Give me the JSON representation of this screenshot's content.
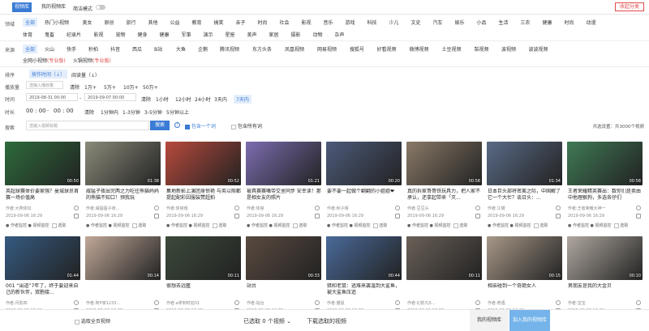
{
  "tabs": [
    {
      "label": "视频库"
    },
    {
      "label": "我的视频库"
    }
  ],
  "mode_label": "简洁模式",
  "fav_button": "收起分类",
  "labels": {
    "domain": "领域",
    "source": "来源",
    "sort": "排序",
    "plays": "播放量",
    "time": "时间",
    "duration": "时长",
    "search": "搜索"
  },
  "domain_row1": [
    "全部",
    "热门小视频",
    "美女",
    "原创",
    "旅行",
    "其他",
    "公益",
    "教育",
    "搞笑",
    "亲子",
    "时尚",
    "社会",
    "影视",
    "音乐",
    "游戏",
    "科技",
    "少儿",
    "文史",
    "汽车",
    "娱乐",
    "小品",
    "生活",
    "三农",
    "健康",
    "时尚",
    "动漫"
  ],
  "domain_row2": [
    "体育",
    "鬼畜",
    "纪录片",
    "影视",
    "宠物",
    "健身",
    "健康",
    "军事",
    "演示",
    "星座",
    "美声",
    "家居",
    "摄影",
    "动物",
    "杂声"
  ],
  "source_row1": [
    "全部",
    "火山",
    "快手",
    "秒拍",
    "抖音",
    "西瓜",
    "B站",
    "大鱼",
    "企鹅",
    "腾讯视频",
    "东方头条",
    "凤凰视频",
    "网易视频",
    "搜狐号",
    "好看视频",
    "微博视频",
    "土豆视频",
    "梨视频",
    "波视频",
    "波波视频"
  ],
  "source_row1_tags": [
    "(专业版)",
    "(专业版)",
    "(专业版)",
    "(专业版)",
    "(专业版)",
    "(专业版)"
  ],
  "source_row2": [
    "全网小视频",
    "火锅视频"
  ],
  "sort_opts": [
    "按作时间（↓）",
    "阅读量（↓）"
  ],
  "plays_clear": "清除",
  "plays_opts": [
    "1万+",
    "5万+",
    "10万+",
    "50万+"
  ],
  "plays_input_placeholder": "选输入播放量",
  "time_from": "2019-08-31 00:00",
  "time_to": "2019-09-07 00:00",
  "time_clear": "清除",
  "time_opts": [
    "1小时",
    "12小时",
    "24小时",
    "3天内",
    "7天内"
  ],
  "duration_from": "00 : 00",
  "duration_to": "00 : 00",
  "duration_clear": "清除",
  "duration_opts": [
    "1分钟内",
    "1-3分钟",
    "3-5分钟",
    "5分钟以上"
  ],
  "search_placeholder": "选输入视频标题",
  "search_button": "搜索",
  "search_cb1": "包含一个词",
  "search_cb2": "包含所有词",
  "result_count": "共选设置：共3000个视频",
  "videos": [
    {
      "title": "英超球赛体价要家强？曼城球员首赛一场价值高",
      "author": "作者:大燕体坛",
      "date": "2019-09-06 16:29",
      "dur": "00:50",
      "color": "#2d6b3b"
    },
    {
      "title": "威猛子夜出完两之力吃往熊猫妈妈的熊猫不知口！预我玩",
      "author": "作者:威猛猛子夜...",
      "date": "2019-09-06 16:29",
      "dur": "01:38",
      "color": "#8a8a7a"
    },
    {
      "title": "集地新影上演团身惊艳 与英以照都提起配彩因服装赞超拍",
      "author": "作者:体官瑶",
      "date": "2019-09-06 16:29",
      "dur": "00:52",
      "color": "#b74a3c"
    },
    {
      "title": "被具赛赛嘴带交里同步 安幸读！那是相女友的照片",
      "author": "作者:体官",
      "date": "2019-09-06 16:29",
      "dur": "01:21",
      "color": "#7c6db0"
    },
    {
      "title": "要不要一起做个翻翻的小姐姐❤",
      "author": "作者:秋子晴",
      "date": "2019-09-06 16:29",
      "dur": "00:20",
      "color": "#4d5a7a"
    },
    {
      "title": "真的拆家哥哥铁玩具力，把人家不承认，还拿起带来「灭...",
      "author": "作者:豆豆头",
      "date": "2019-09-06 16:29",
      "dur": "00:58",
      "color": "#8a7a68"
    },
    {
      "title": "日本巨头部将密离之际，中国解了它一个大忙？谈日头：...",
      "author": "作者:江曜",
      "date": "2019-09-06 16:29",
      "dur": "01:34",
      "color": "#5a6a86"
    },
    {
      "title": "王者荣耀精英赛出：数你们是卖由中他理狠狗，多选各仔们",
      "author": "作者:王者荣耀大神一",
      "date": "2019-09-06 16:29",
      "dur": "00:58",
      "color": "#3f7a55"
    },
    {
      "title": "001 “出道”7年了，终于要迎来自己的新伙伴，双胞接...",
      "author": "作者:月影四",
      "date": "2019-09-06 16:29",
      "dur": "01:44",
      "color": "#355a80"
    },
    {
      "title": "",
      "author": "作者:阿P家1233...",
      "date": "2019-09-06 16:29",
      "dur": "00:14",
      "color": "#c0a898"
    },
    {
      "title": "很想去远匿",
      "author": "作者:a拿到时拍31",
      "date": "2019-09-06 16:29",
      "dur": "00:11",
      "color": "#3c4a3a"
    },
    {
      "title": "站台",
      "author": "作者:站台",
      "date": "2019-09-06 16:29",
      "dur": "00:33",
      "color": "#5a4a40"
    },
    {
      "title": "猎和老鼠：逃难来袭温到大鲨鱼，被大鲨鱼压追",
      "author": "作者:猫鼠",
      "date": "2019-09-06 16:29",
      "dur": "00:44",
      "color": "#4a6a9a"
    },
    {
      "title": "",
      "author": "作者:幻影丸5...",
      "date": "2019-09-06 16:29",
      "dur": "00:11",
      "color": "#6a6058"
    },
    {
      "title": "相亲碰到一个奇葩女人",
      "author": "作者:奇遇",
      "date": "2019-09-06 16:29",
      "dur": "00:15",
      "color": "#a89888"
    },
    {
      "title": "男朋友是我的大金贝",
      "author": "作者:宝宝",
      "date": "2019-09-06 16:29",
      "dur": "00:10",
      "color": "#b0a8a0"
    }
  ],
  "card_actions": "● 作者监控   ● 视频监控",
  "card_select": "选取",
  "bottom": {
    "select_all": "选取全页视频",
    "selected": "已选取 0 个视频 ⌄",
    "download": "下载选取的视频",
    "my_lib": "我的视频库",
    "add_lib": "加入我的视频库"
  }
}
